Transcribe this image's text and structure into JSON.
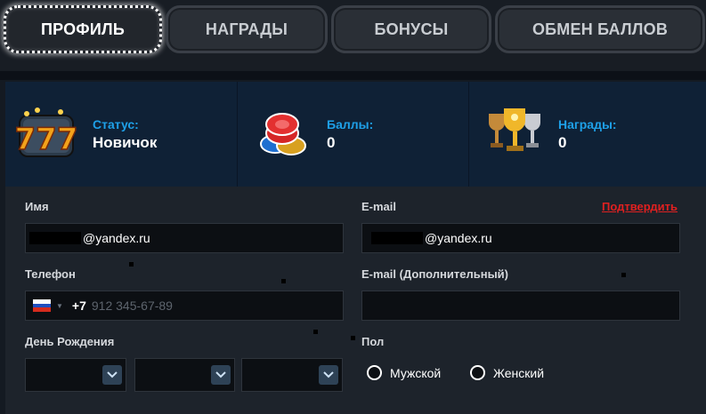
{
  "tabs": [
    {
      "label": "ПРОФИЛЬ",
      "active": true
    },
    {
      "label": "НАГРАДЫ",
      "active": false
    },
    {
      "label": "БОНУСЫ",
      "active": false
    },
    {
      "label": "ОБМЕН БАЛЛОВ",
      "active": false
    }
  ],
  "stats": [
    {
      "label": "Статус:",
      "value": "Новичок",
      "icon": "slot-777-icon"
    },
    {
      "label": "Баллы:",
      "value": "0",
      "icon": "casino-chips-icon"
    },
    {
      "label": "Награды:",
      "value": "0",
      "icon": "trophies-icon"
    }
  ],
  "form": {
    "name_label": "Имя",
    "name_value": "@yandex.ru",
    "email_label": "E-mail",
    "email_value": "@yandex.ru",
    "confirm_label": "Подтвердить",
    "phone_label": "Телефон",
    "phone_code": "+7",
    "phone_placeholder": "912 345-67-89",
    "email2_label": "E-mail (Дополнительный)",
    "email2_value": "",
    "birthday_label": "День Рождения",
    "gender_label": "Пол",
    "gender_male": "Мужской",
    "gender_female": "Женский"
  },
  "colors": {
    "accent_blue": "#1ea0e8",
    "confirm_red": "#e02020",
    "panel_navy": "#0f2136"
  }
}
